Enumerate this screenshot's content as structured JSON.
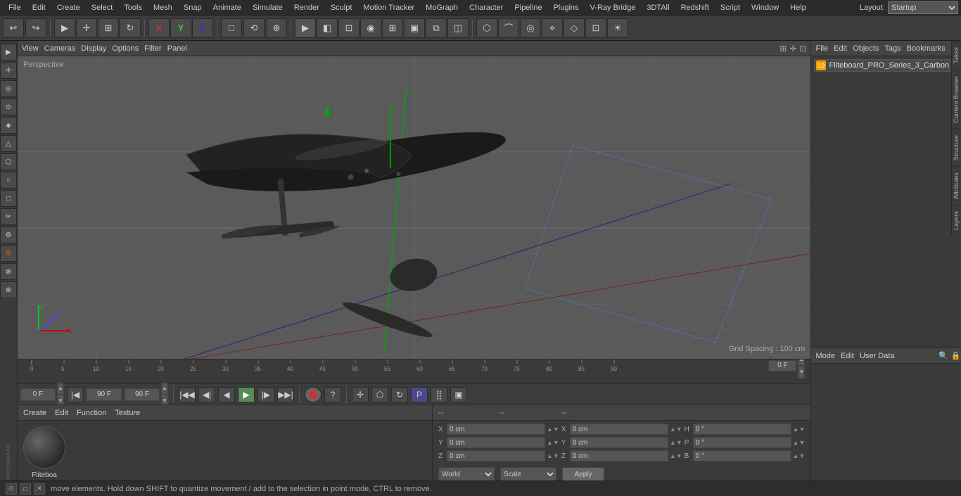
{
  "menu_bar": {
    "items": [
      "File",
      "Edit",
      "Create",
      "Select",
      "Tools",
      "Mesh",
      "Snap",
      "Animate",
      "Simulate",
      "Render",
      "Sculpt",
      "Motion Tracker",
      "MoGraph",
      "Character",
      "Pipeline",
      "Plugins",
      "V-Ray Bridge",
      "3DTAll",
      "Redshift",
      "Script",
      "Window",
      "Help"
    ],
    "layout_label": "Layout:",
    "layout_value": "Startup"
  },
  "toolbar": {
    "undo_icon": "↩",
    "redo_icon": "↪",
    "select_icon": "▶",
    "move_icon": "✛",
    "scale_icon": "⊞",
    "rotate_icon": "↻",
    "x_axis": "X",
    "y_axis": "Y",
    "z_axis": "Z",
    "object_mode": "□",
    "render_btn": "▶",
    "ipr_btn": "◧",
    "viewport_icon": "⊡"
  },
  "viewport": {
    "menus": [
      "View",
      "Cameras",
      "Display",
      "Options",
      "Filter",
      "Panel"
    ],
    "label": "Perspective",
    "grid_spacing": "Grid Spacing : 100 cm"
  },
  "timeline": {
    "ticks": [
      0,
      5,
      10,
      15,
      20,
      25,
      30,
      35,
      40,
      45,
      50,
      55,
      60,
      65,
      70,
      75,
      80,
      85,
      90
    ],
    "current_frame": "0 F",
    "start_frame": "0 F",
    "end_frame": "90 F",
    "preview_start": "90 F"
  },
  "transport": {
    "frame_field": "0 F",
    "start_field": "0 F",
    "end_field": "90 F",
    "preview_field": "90 F"
  },
  "object_manager": {
    "menus": [
      "File",
      "Edit",
      "Objects",
      "Tags",
      "Bookmarks"
    ],
    "object_name": "Fliteboard_PRO_Series_3_Carbon",
    "object_icon": "L0"
  },
  "attributes": {
    "menus": [
      "Mode",
      "Edit",
      "User Data"
    ]
  },
  "material": {
    "menus": [
      "Create",
      "Edit",
      "Function",
      "Texture"
    ],
    "name": "Fliteboa"
  },
  "coordinates": {
    "x_pos": "0 cm",
    "y_pos": "0 cm",
    "z_pos": "0 cm",
    "x_size": "0 cm",
    "y_size": "0 cm",
    "z_size": "0 cm",
    "h_rot": "0 °",
    "p_rot": "0 °",
    "b_rot": "0 °",
    "world_label": "World",
    "scale_label": "Scale",
    "apply_label": "Apply"
  },
  "status_bar": {
    "text": "move elements. Hold down SHIFT to quantize movement / add to the selection in point mode, CTRL to remove."
  },
  "vertical_tabs": [
    "Takes",
    "Content Browser",
    "Structure",
    "Attributes",
    "Layers"
  ],
  "left_sidebar_icons": [
    "▶",
    "✛",
    "⊞",
    "↻",
    "◈",
    "⟳",
    "○",
    "△",
    "□",
    "⬡",
    "✂",
    "⚙",
    "S",
    "⊙",
    "⊗"
  ]
}
